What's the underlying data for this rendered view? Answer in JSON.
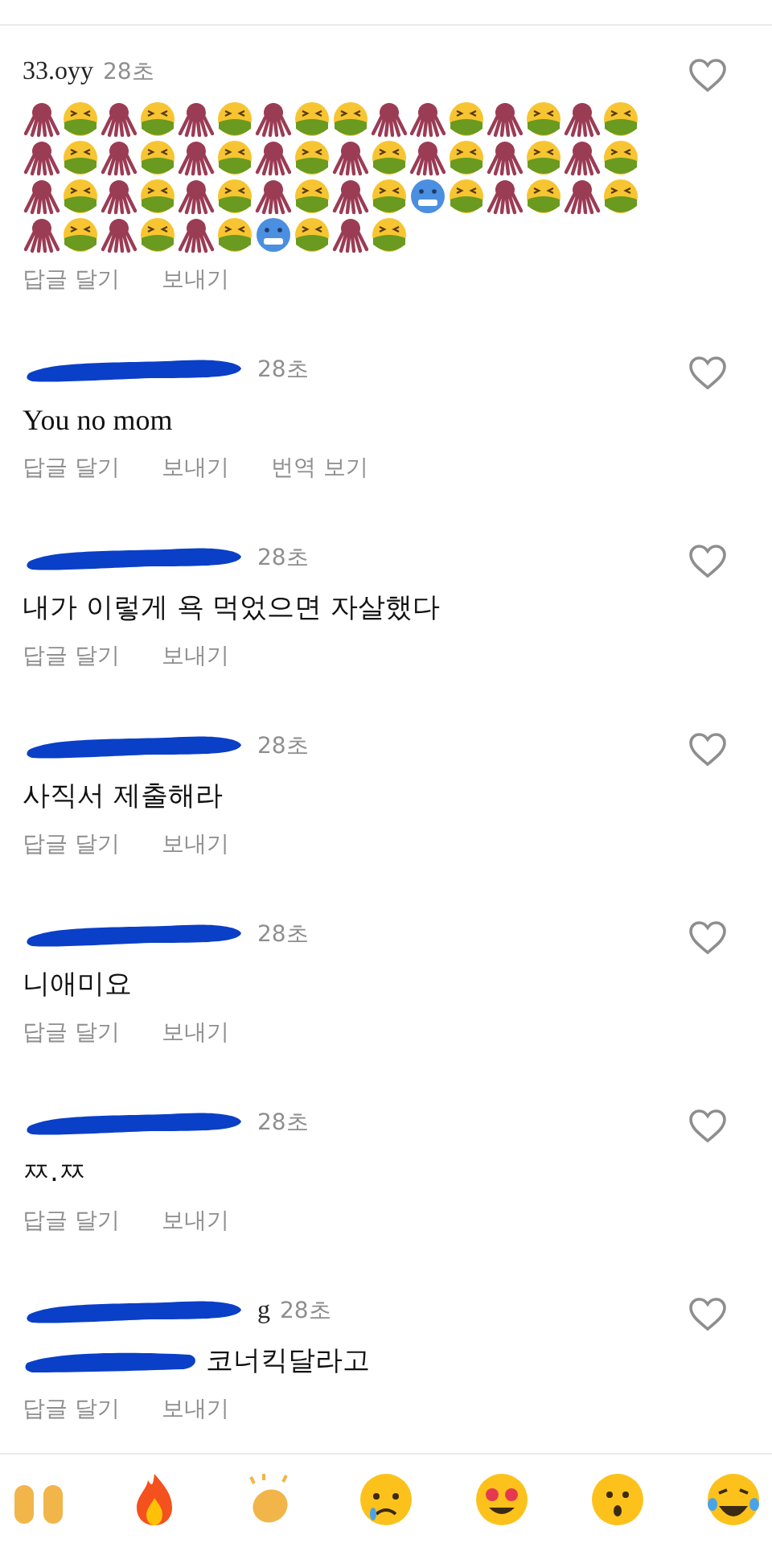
{
  "comments": [
    {
      "username": "33.oyy",
      "redacted": false,
      "time": "28초",
      "kind": "emoji",
      "emojis": [
        {
          "kind": "octopus"
        },
        {
          "kind": "nauseated"
        },
        {
          "kind": "octopus"
        },
        {
          "kind": "nauseated"
        },
        {
          "kind": "octopus"
        },
        {
          "kind": "nauseated"
        },
        {
          "kind": "octopus"
        },
        {
          "kind": "nauseated"
        },
        {
          "kind": "nauseated"
        },
        {
          "kind": "octopus"
        },
        {
          "kind": "octopus"
        },
        {
          "kind": "nauseated"
        },
        {
          "kind": "octopus"
        },
        {
          "kind": "nauseated"
        },
        {
          "kind": "octopus"
        },
        {
          "kind": "nauseated"
        },
        {
          "kind": "octopus"
        },
        {
          "kind": "nauseated"
        },
        {
          "kind": "octopus"
        },
        {
          "kind": "nauseated"
        },
        {
          "kind": "octopus"
        },
        {
          "kind": "nauseated"
        },
        {
          "kind": "octopus"
        },
        {
          "kind": "nauseated"
        },
        {
          "kind": "octopus"
        },
        {
          "kind": "nauseated"
        },
        {
          "kind": "octopus"
        },
        {
          "kind": "nauseated"
        },
        {
          "kind": "octopus"
        },
        {
          "kind": "nauseated"
        },
        {
          "kind": "octopus"
        },
        {
          "kind": "nauseated"
        },
        {
          "kind": "octopus"
        },
        {
          "kind": "nauseated"
        },
        {
          "kind": "octopus"
        },
        {
          "kind": "nauseated"
        },
        {
          "kind": "octopus"
        },
        {
          "kind": "nauseated"
        },
        {
          "kind": "octopus"
        },
        {
          "kind": "nauseated"
        },
        {
          "kind": "octopus"
        },
        {
          "kind": "nauseated"
        },
        {
          "kind": "cold"
        },
        {
          "kind": "nauseated"
        },
        {
          "kind": "octopus"
        },
        {
          "kind": "nauseated"
        },
        {
          "kind": "octopus"
        },
        {
          "kind": "nauseated"
        },
        {
          "kind": "octopus"
        },
        {
          "kind": "nauseated"
        },
        {
          "kind": "octopus"
        },
        {
          "kind": "nauseated"
        },
        {
          "kind": "octopus"
        },
        {
          "kind": "nauseated"
        },
        {
          "kind": "cold"
        },
        {
          "kind": "nauseated"
        },
        {
          "kind": "octopus"
        },
        {
          "kind": "nauseated"
        }
      ],
      "actions": [
        "답글 달기",
        "보내기"
      ],
      "liked": false
    },
    {
      "redacted": true,
      "time": "28초",
      "kind": "text",
      "body": "You no mom",
      "actions": [
        "답글 달기",
        "보내기",
        "번역 보기"
      ],
      "liked": false
    },
    {
      "redacted": true,
      "time": "28초",
      "kind": "text",
      "body": "내가 이렇게 욕 먹었으면 자살했다",
      "actions": [
        "답글 달기",
        "보내기"
      ],
      "liked": false
    },
    {
      "redacted": true,
      "time": "28초",
      "kind": "text",
      "body": "사직서 제출해라",
      "actions": [
        "답글 달기",
        "보내기"
      ],
      "liked": false
    },
    {
      "redacted": true,
      "time": "28초",
      "kind": "text",
      "body": "니애미요",
      "actions": [
        "답글 달기",
        "보내기"
      ],
      "liked": false
    },
    {
      "redacted": true,
      "time": "28초",
      "kind": "text",
      "body": "ㅉ.ㅉ",
      "actions": [
        "답글 달기",
        "보내기"
      ],
      "liked": false
    },
    {
      "redacted": true,
      "username": "g",
      "time": "28초",
      "kind": "mention",
      "body": "코너킥달라고",
      "actions": [
        "답글 달기",
        "보내기"
      ],
      "liked": false
    }
  ],
  "reactions": [
    {
      "kind": "raised-hands"
    },
    {
      "kind": "fire"
    },
    {
      "kind": "clap"
    },
    {
      "kind": "crying"
    },
    {
      "kind": "heart-eyes"
    },
    {
      "kind": "surprised"
    },
    {
      "kind": "tears-of-joy"
    }
  ]
}
